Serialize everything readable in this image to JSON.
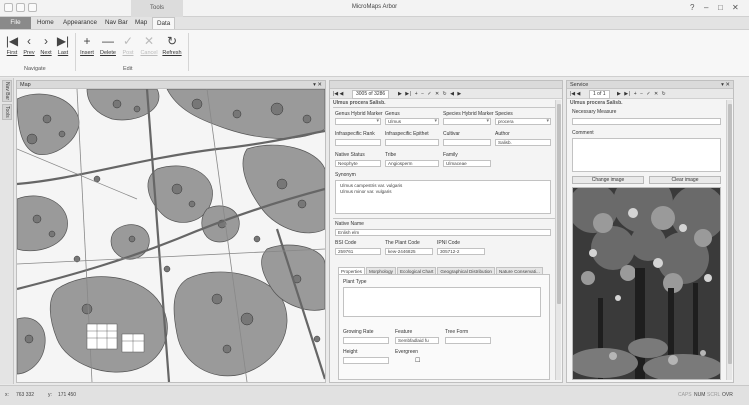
{
  "app": {
    "title": "MicroMaps Arbor",
    "context_tab": "Tools"
  },
  "ribbon": {
    "tabs": [
      "File",
      "Home",
      "Appearance",
      "Nav Bar",
      "Map",
      "Data"
    ],
    "active_tab": "Data",
    "navigate": {
      "group": "Navigate",
      "first": "First",
      "prev": "Prev",
      "next": "Next",
      "last": "Last"
    },
    "edit": {
      "group": "Edit",
      "insert": "Insert",
      "delete": "Delete",
      "post": "Post",
      "cancel": "Cancel",
      "refresh": "Refresh"
    }
  },
  "sidebar": {
    "tabs": [
      "Nav Bar",
      "Tools"
    ]
  },
  "map": {
    "title": "Map"
  },
  "record": {
    "nav_text": "3005 of 3286",
    "heading": "Ulmus procera Salisb.",
    "genus_hybrid_label": "Genus Hybrid Marker",
    "genus_label": "Genus",
    "genus_value": "Ulmus",
    "species_hybrid_label": "Species Hybrid Marker",
    "species_label": "Species",
    "species_value": "procera",
    "infra_rank_label": "Infraspecific Rank",
    "infra_epithet_label": "Infraspecific Epithet",
    "cultivar_label": "Cultivar",
    "author_label": "Author",
    "author_value": "Salisb.",
    "native_status_label": "Native Status",
    "native_status_value": "Neophyte",
    "tribe_label": "Tribe",
    "tribe_value": "Angiosperm",
    "family_label": "Family",
    "family_value": "Ulmaceae",
    "synonym_label": "Synonym",
    "synonyms": [
      "Ulmus campestris var. vulgaris",
      "Ulmus minor var. vulgaris"
    ],
    "native_name_label": "Native Name",
    "native_name_value": "Enlish elm",
    "bsi_label": "BSI Code",
    "bsi_value": "259761",
    "plant_code_label": "The Plant Code",
    "plant_code_value": "kew-2446825",
    "ipni_label": "IPNI Code",
    "ipni_value": "305712-2",
    "subtabs": [
      "Properties",
      "Morphology",
      "Ecological Chart",
      "Geographical Distribution",
      "Nature Conservati..."
    ],
    "plant_type_label": "Plant Type",
    "growing_rate_label": "Growing Rate",
    "feature_label": "Feature",
    "feature_value": "Sembfadlaid fu",
    "tree_form_label": "Tree Form",
    "height_label": "Height",
    "evergreen_label": "Evergreen",
    "evergreen_value": "☐"
  },
  "service": {
    "title": "Service",
    "nav_text": "1 of 1",
    "heading": "Ulmus procera Salisb.",
    "measure_label": "Necessary Measure",
    "comment_label": "Comment",
    "change_image": "Change image",
    "clear_image": "Clear image"
  },
  "status": {
    "x_label": "x:",
    "x_value": "763 332",
    "y_label": "y:",
    "y_value": "171 450",
    "indicators": [
      "CAPS",
      "NUM",
      "SCRL",
      "OVR"
    ]
  }
}
